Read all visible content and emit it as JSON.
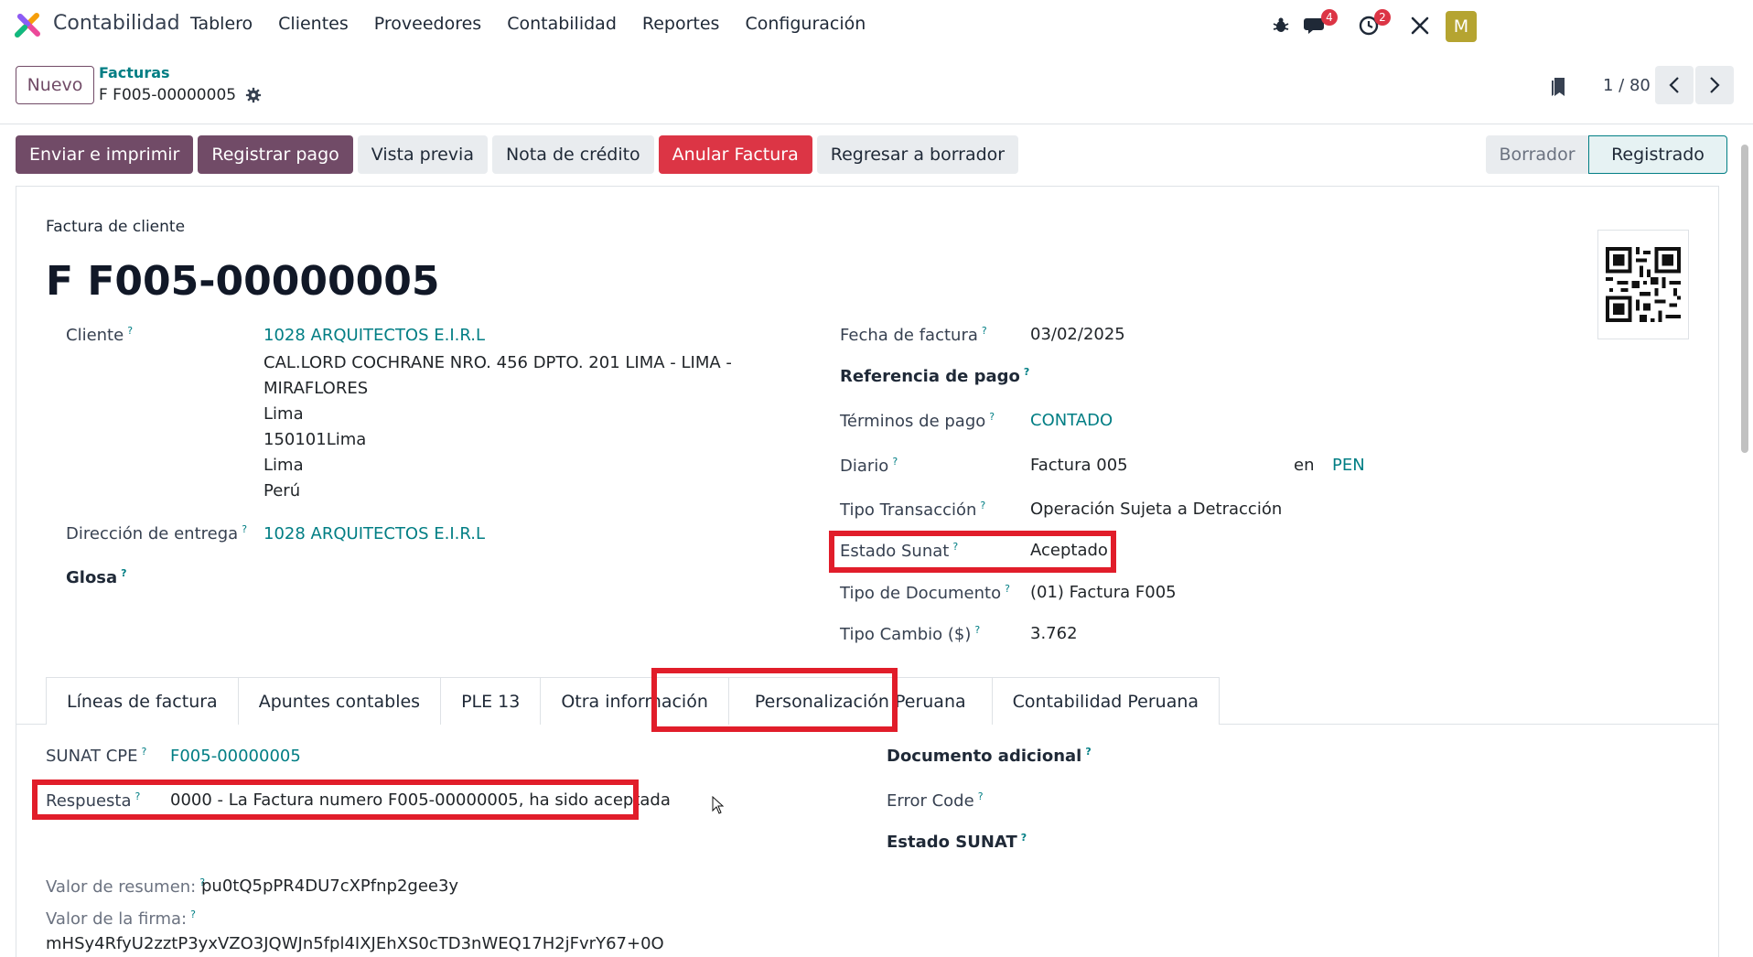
{
  "navbar": {
    "app_name": "Contabilidad",
    "menu": [
      "Tablero",
      "Clientes",
      "Proveedores",
      "Contabilidad",
      "Reportes",
      "Configuración"
    ],
    "chat_badge": "4",
    "activity_badge": "2",
    "avatar_letter": "M",
    "avatar_color": "#b5a431"
  },
  "control": {
    "new_label": "Nuevo",
    "breadcrumb_parent": "Facturas",
    "breadcrumb_current": "F F005-00000005",
    "pager_value": "1 / 80"
  },
  "actions": {
    "send_print": "Enviar e imprimir",
    "register_payment": "Registrar pago",
    "preview": "Vista previa",
    "credit_note": "Nota de crédito",
    "cancel_invoice": "Anular Factura",
    "back_to_draft": "Regresar a borrador"
  },
  "status": {
    "draft": "Borrador",
    "posted": "Registrado"
  },
  "form": {
    "subtitle": "Factura de cliente",
    "title": "F F005-00000005",
    "customer_label": "Cliente",
    "customer_value": "1028 ARQUITECTOS E.I.R.L",
    "address_lines": [
      "CAL.LORD COCHRANE NRO. 456 DPTO. 201 LIMA - LIMA -",
      "MIRAFLORES",
      "Lima",
      "150101Lima",
      "Lima",
      "Perú"
    ],
    "delivery_label": "Dirección de entrega",
    "delivery_value": "1028 ARQUITECTOS E.I.R.L",
    "glosa_label": "Glosa",
    "invoice_date_label": "Fecha de factura",
    "invoice_date_value": "03/02/2025",
    "payment_ref_label": "Referencia de pago",
    "payment_terms_label": "Términos de pago",
    "payment_terms_value": "CONTADO",
    "journal_label": "Diario",
    "journal_value": "Factura 005",
    "journal_in": "en",
    "currency": "PEN",
    "transaction_type_label": "Tipo Transacción",
    "transaction_type_value": "Operación Sujeta a Detracción",
    "sunat_state_label": "Estado Sunat",
    "sunat_state_value": "Aceptado",
    "doc_type_label": "Tipo de Documento",
    "doc_type_value": "(01) Factura F005",
    "exchange_label": "Tipo Cambio ($)",
    "exchange_value": "3.762"
  },
  "tabs": [
    "Líneas de factura",
    "Apuntes contables",
    "PLE 13",
    "Otra información",
    "Personalización Peruana",
    "Contabilidad Peruana"
  ],
  "tab_content": {
    "cpe_label": "SUNAT CPE",
    "cpe_value": "F005-00000005",
    "response_label": "Respuesta",
    "response_value": "0000 - La Factura numero F005-00000005, ha sido aceptada",
    "extra_doc_label": "Documento adicional",
    "error_code_label": "Error Code",
    "sunat_status_label": "Estado SUNAT",
    "summary_label": "Valor de resumen:",
    "summary_value": "pu0tQ5pPR4DU7cXPfnp2gee3y",
    "signature_label": "Valor de la firma:",
    "signature_value": "mHSy4RfyU2zztP3yxVZO3JQWJn5fpl4IXJEhXS0cTD3nWEQ17H2jFvrY67+0O"
  }
}
